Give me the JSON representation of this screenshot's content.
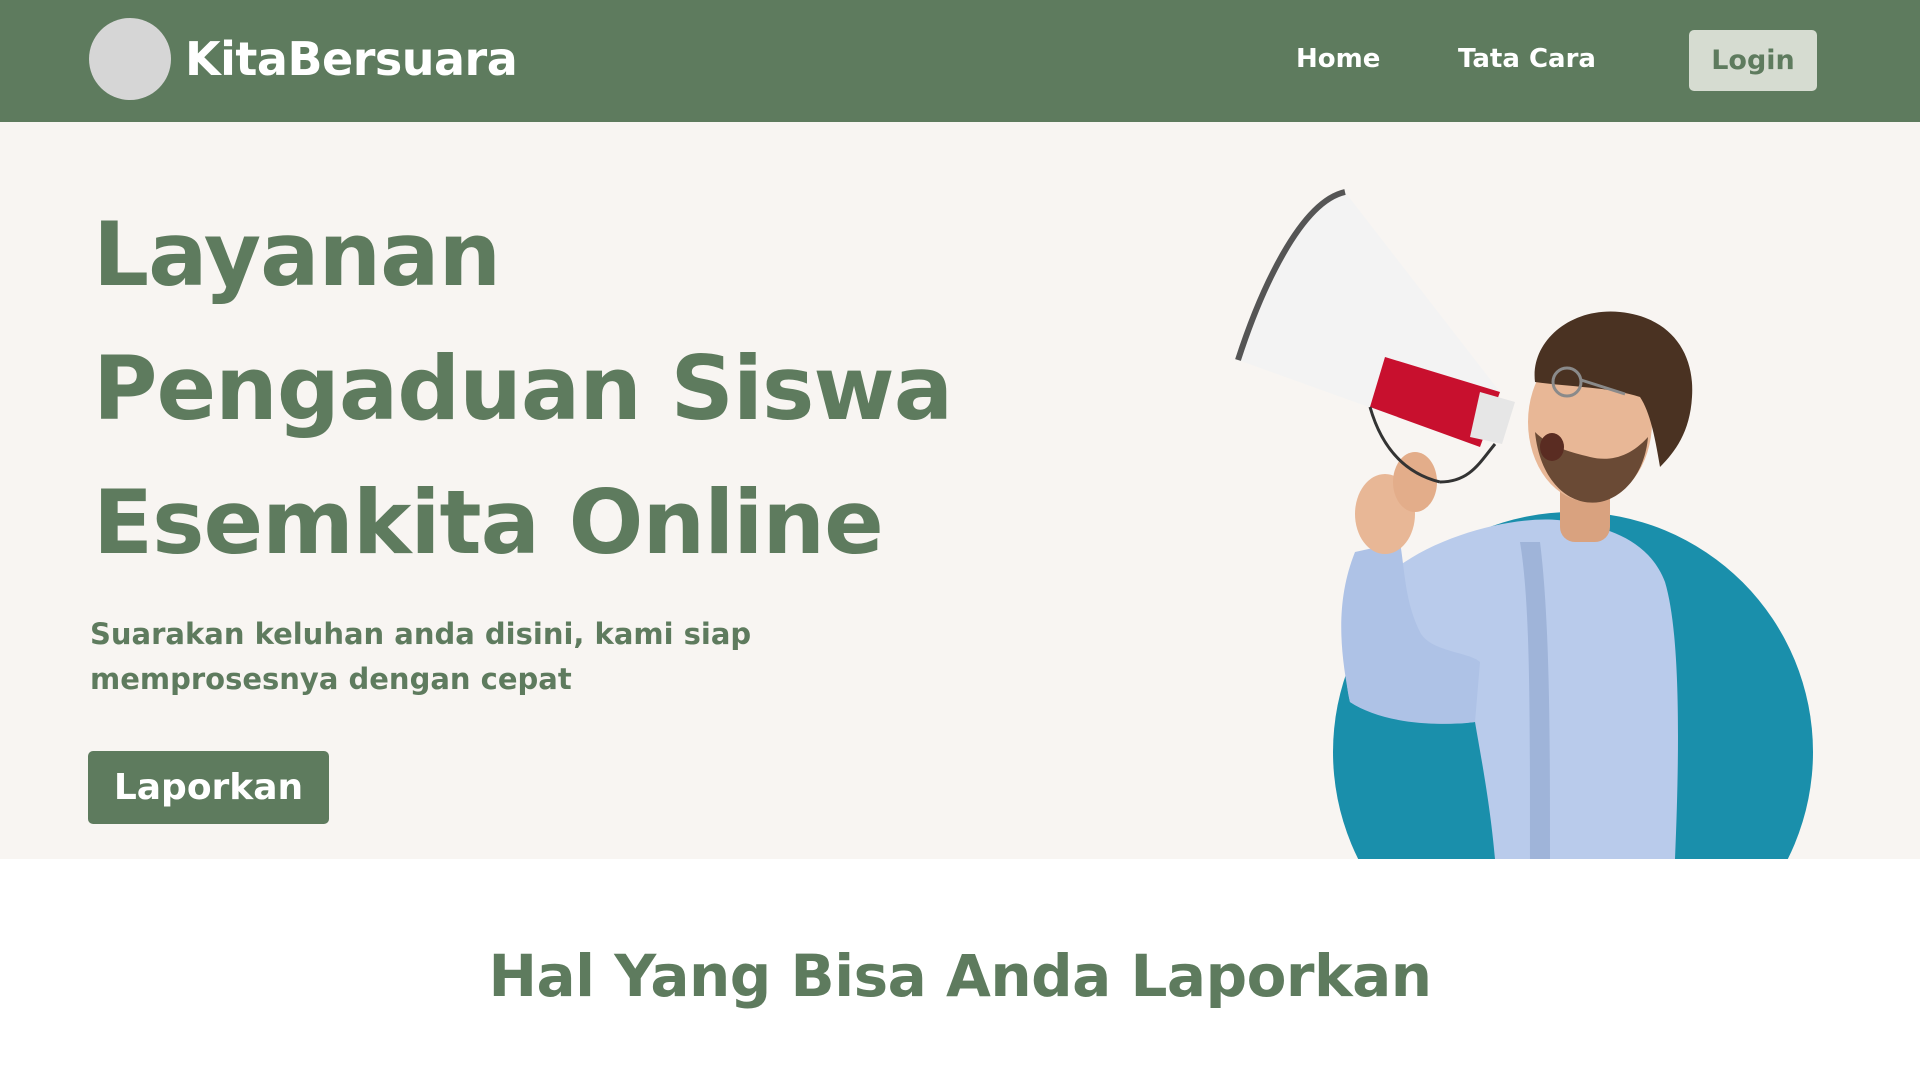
{
  "navbar": {
    "brand_name": "KitaBersuara",
    "links": [
      {
        "label": "Home"
      },
      {
        "label": "Tata Cara"
      }
    ],
    "login_label": "Login"
  },
  "hero": {
    "title_lines": [
      "Layanan",
      "Pengaduan Siswa",
      "Esemkita Online"
    ],
    "subtitle": "Suarakan keluhan anda disini, kami siap memprosesnya dengan cepat",
    "cta_label": "Laporkan",
    "illustration": "man-shouting-into-megaphone"
  },
  "section": {
    "title": "Hal Yang Bisa Anda Laporkan"
  },
  "colors": {
    "primary_green": "#5e7b5e",
    "hero_background": "#f8f5f2",
    "login_button_bg": "#d6dcd1",
    "accent_teal": "#1a8fab",
    "megaphone_red": "#c8102e"
  }
}
